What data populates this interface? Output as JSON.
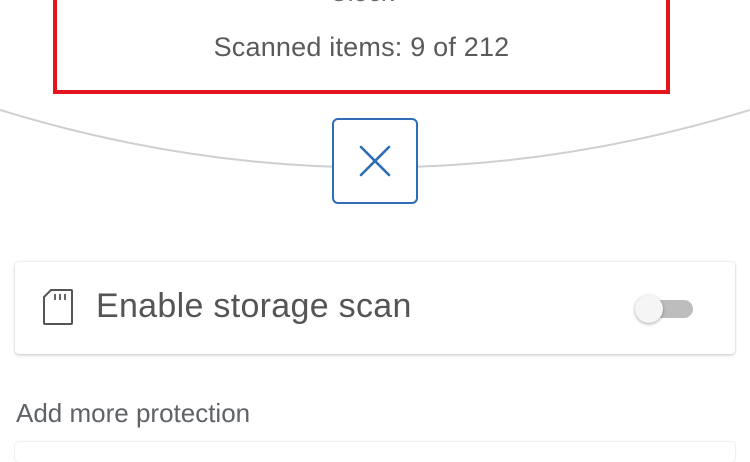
{
  "scan": {
    "app_name": "Clock",
    "progress_text": "Scanned items: 9 of 212",
    "scanned": 9,
    "total": 212
  },
  "cancel": {
    "icon": "close-icon",
    "color": "#2f6db5"
  },
  "storage_scan": {
    "icon": "sd-card-icon",
    "label": "Enable storage scan",
    "enabled": false
  },
  "protection": {
    "title": "Add more protection"
  },
  "colors": {
    "highlight": "#e3141b",
    "accent": "#2f6db5"
  }
}
